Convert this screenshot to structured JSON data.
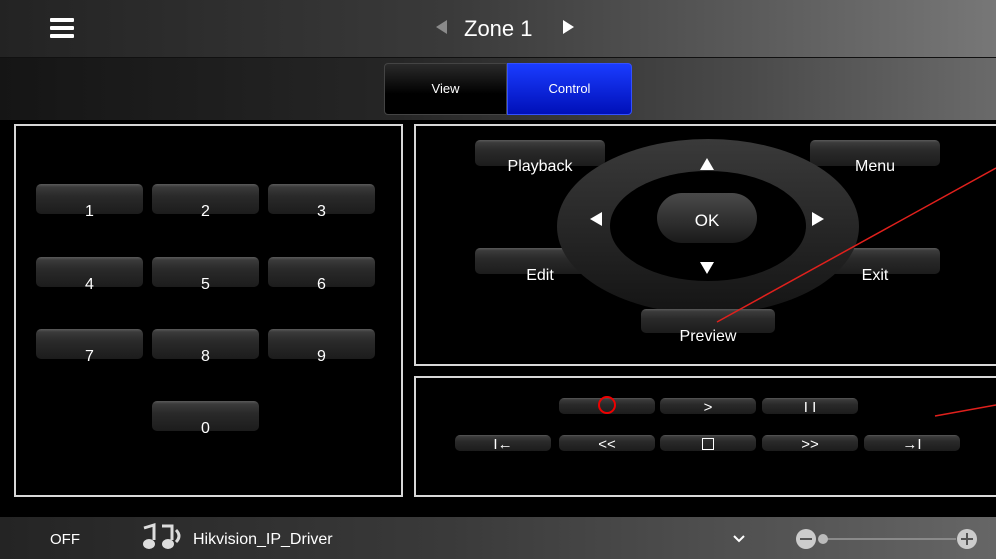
{
  "header": {
    "zone_title": "Zone 1"
  },
  "tabs": [
    {
      "label": "View",
      "selected": false
    },
    {
      "label": "Control",
      "selected": true
    }
  ],
  "numpad": {
    "keys": [
      "1",
      "2",
      "3",
      "4",
      "5",
      "6",
      "7",
      "8",
      "9",
      "0"
    ]
  },
  "navigation": {
    "playback_label": "Playback",
    "menu_label": "Menu",
    "edit_label": "Edit",
    "exit_label": "Exit",
    "ok_label": "OK",
    "preview_label": "Preview"
  },
  "transport": {
    "next_label": ">",
    "pause_label": "I I",
    "skip_back_label": "I←",
    "rewind_label": "<<",
    "fast_forward_label": ">>",
    "skip_forward_label": "→I"
  },
  "footer": {
    "power_label": "OFF",
    "device_name": "Hikvision_IP_Driver",
    "volume_level": 0.03
  },
  "colors": {
    "accent": "#0a22e6",
    "record": "#ee0000",
    "annotation_line": "#e0201c"
  }
}
